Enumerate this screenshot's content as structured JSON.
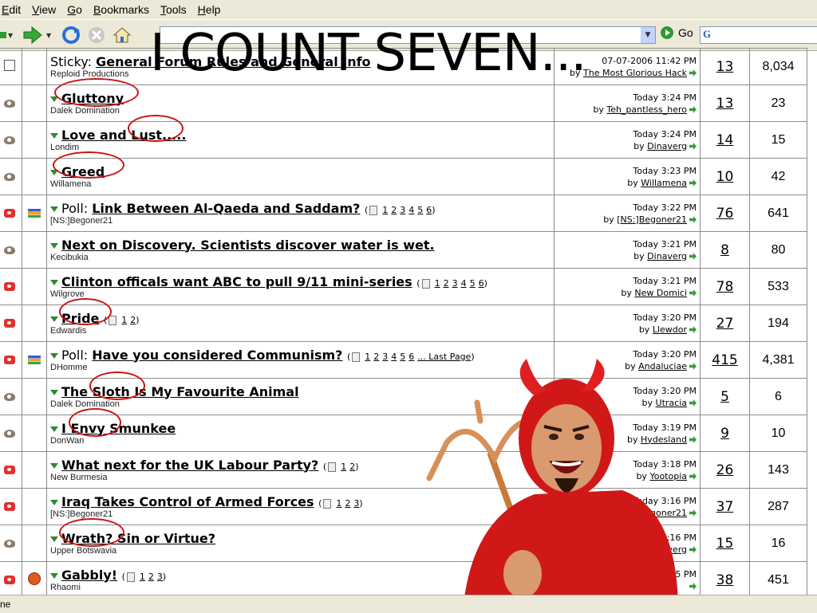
{
  "menu": [
    "Edit",
    "View",
    "Go",
    "Bookmarks",
    "Tools",
    "Help"
  ],
  "toolbar": {
    "go_label": "Go",
    "search_logo": "G"
  },
  "caption": "I COUNT SEVEN...",
  "status_text": "ne",
  "threads": [
    {
      "icon": "sticky-icon",
      "post_icon": "",
      "prefix": "Sticky: ",
      "title": "General Forum Rules and General Info",
      "pages": [],
      "author": "Reploid Productions",
      "last_date": "07-07-2006 11:42 PM",
      "last_by": "The Most Glorious Hack",
      "replies": "13",
      "views": "8,034"
    },
    {
      "icon": "eye-icon",
      "post_icon": "",
      "prefix": "",
      "title": "Gluttony",
      "pages": [],
      "author": "Dalek Domination",
      "last_date": "Today 3:24 PM",
      "last_by": "Teh_pantless_hero",
      "replies": "13",
      "views": "23"
    },
    {
      "icon": "eye-icon",
      "post_icon": "",
      "prefix": "",
      "title": "Love and Lust.....",
      "pages": [],
      "author": "Londim",
      "last_date": "Today 3:24 PM",
      "last_by": "Dinaverg",
      "replies": "14",
      "views": "15"
    },
    {
      "icon": "eye-icon",
      "post_icon": "",
      "prefix": "",
      "title": "Greed",
      "pages": [],
      "author": "Willamena",
      "last_date": "Today 3:23 PM",
      "last_by": "Willamena",
      "replies": "10",
      "views": "42"
    },
    {
      "icon": "hot-icon",
      "post_icon": "poll-icon",
      "prefix": "Poll: ",
      "title": "Link Between Al-Qaeda and Saddam?",
      "pages": [
        "1",
        "2",
        "3",
        "4",
        "5",
        "6"
      ],
      "author": "[NS:]Begoner21",
      "last_date": "Today 3:22 PM",
      "last_by": "[NS:]Begoner21",
      "replies": "76",
      "views": "641"
    },
    {
      "icon": "eye-icon",
      "post_icon": "",
      "prefix": "",
      "title": "Next on Discovery. Scientists discover water is wet.",
      "pages": [],
      "author": "Kecibukia",
      "last_date": "Today 3:21 PM",
      "last_by": "Dinaverg",
      "replies": "8",
      "views": "80"
    },
    {
      "icon": "hot-icon",
      "post_icon": "",
      "prefix": "",
      "title": "Clinton officals want ABC to pull 9/11 mini-series",
      "pages": [
        "1",
        "2",
        "3",
        "4",
        "5",
        "6"
      ],
      "author": "Wilgrove",
      "last_date": "Today 3:21 PM",
      "last_by": "New Domici",
      "replies": "78",
      "views": "533"
    },
    {
      "icon": "hot-icon",
      "post_icon": "",
      "prefix": "",
      "title": "Pride",
      "pages": [
        "1",
        "2"
      ],
      "author": "Edwardis",
      "last_date": "Today 3:20 PM",
      "last_by": "Llewdor",
      "replies": "27",
      "views": "194"
    },
    {
      "icon": "hot-icon",
      "post_icon": "poll-icon",
      "prefix": "Poll: ",
      "title": "Have you considered Communism?",
      "pages": [
        "1",
        "2",
        "3",
        "4",
        "5",
        "6",
        "... Last Page"
      ],
      "author": "DHomme",
      "last_date": "Today 3:20 PM",
      "last_by": "Andaluciae",
      "replies": "415",
      "views": "4,381"
    },
    {
      "icon": "eye-icon",
      "post_icon": "",
      "prefix": "",
      "title": "The Sloth Is My Favourite Animal",
      "pages": [],
      "author": "Dalek Domination",
      "last_date": "Today 3:20 PM",
      "last_by": "Utracia",
      "replies": "5",
      "views": "6"
    },
    {
      "icon": "eye-icon",
      "post_icon": "",
      "prefix": "",
      "title": "I Envy Smunkee",
      "pages": [],
      "author": "DonWan",
      "last_date": "Today 3:19 PM",
      "last_by": "Hydesland",
      "replies": "9",
      "views": "10"
    },
    {
      "icon": "hot-icon",
      "post_icon": "",
      "prefix": "",
      "title": "What next for the UK Labour Party?",
      "pages": [
        "1",
        "2"
      ],
      "author": "New Burmesia",
      "last_date": "Today 3:18 PM",
      "last_by": "Yootopia",
      "replies": "26",
      "views": "143"
    },
    {
      "icon": "hot-icon",
      "post_icon": "",
      "prefix": "",
      "title": "Iraq Takes Control of Armed Forces",
      "pages": [
        "1",
        "2",
        "3"
      ],
      "author": "[NS:]Begoner21",
      "last_date": "Today 3:16 PM",
      "last_by": "[NS:]Begoner21",
      "replies": "37",
      "views": "287"
    },
    {
      "icon": "eye-icon",
      "post_icon": "",
      "prefix": "",
      "title": "Wrath? Sin or Virtue?",
      "pages": [],
      "author": "Upper Botswavia",
      "last_date": "Today 3:16 PM",
      "last_by": "Dinaverg",
      "replies": "15",
      "views": "16"
    },
    {
      "icon": "hot-icon",
      "post_icon": "smile-icon",
      "prefix": "",
      "title": "Gabbly!",
      "pages": [
        "1",
        "2",
        "3"
      ],
      "author": "Rhaomi",
      "last_date": "Today 3:15 PM",
      "last_by": "",
      "replies": "38",
      "views": "451"
    }
  ]
}
